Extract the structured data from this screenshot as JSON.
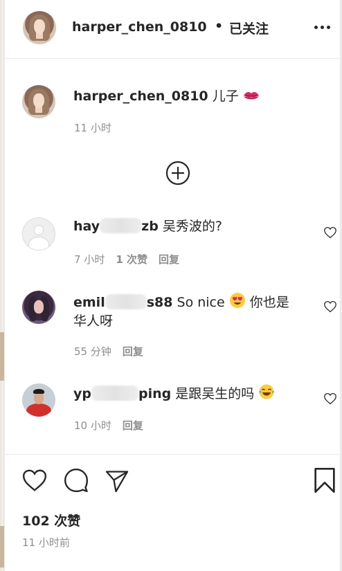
{
  "header": {
    "username": "harper_chen_0810",
    "separator": "•",
    "follow_status": "已关注",
    "more_icon": "more-horizontal-icon"
  },
  "caption": {
    "username": "harper_chen_0810",
    "text": "儿子",
    "emoji_icon": "kiss-lips-icon",
    "time": "11 小时"
  },
  "load_more_icon": "plus-circle-icon",
  "comments": [
    {
      "user_start": "hay",
      "user_end": "zb",
      "text": "吴秀波的?",
      "time": "7 小时",
      "likes": "1 次赞",
      "reply": "回复"
    },
    {
      "user_start": "emil",
      "user_end": "s88",
      "text_before_emoji": "So nice",
      "emoji_icon": "heart-eyes-emoji-icon",
      "text_after_emoji": "你也是",
      "text_line2": "华人呀",
      "time": "55 分钟",
      "reply": "回复"
    },
    {
      "user_start": "yp",
      "user_end": "ping",
      "text": "是跟吴生的吗",
      "emoji_icon": "tears-of-joy-emoji-icon",
      "time": "10 小时",
      "reply": "回复"
    }
  ],
  "actions": {
    "like_icon": "heart-icon",
    "comment_icon": "comment-bubble-icon",
    "share_icon": "paper-plane-icon",
    "save_icon": "bookmark-icon"
  },
  "likes_count": "102 次赞",
  "post_time": "11 小时前",
  "colors": {
    "text": "#262626",
    "secondary": "#8e8e8e",
    "divider": "#e8e8e8",
    "lips": "#e0245e",
    "emoji_yellow": "#ffcc33"
  }
}
